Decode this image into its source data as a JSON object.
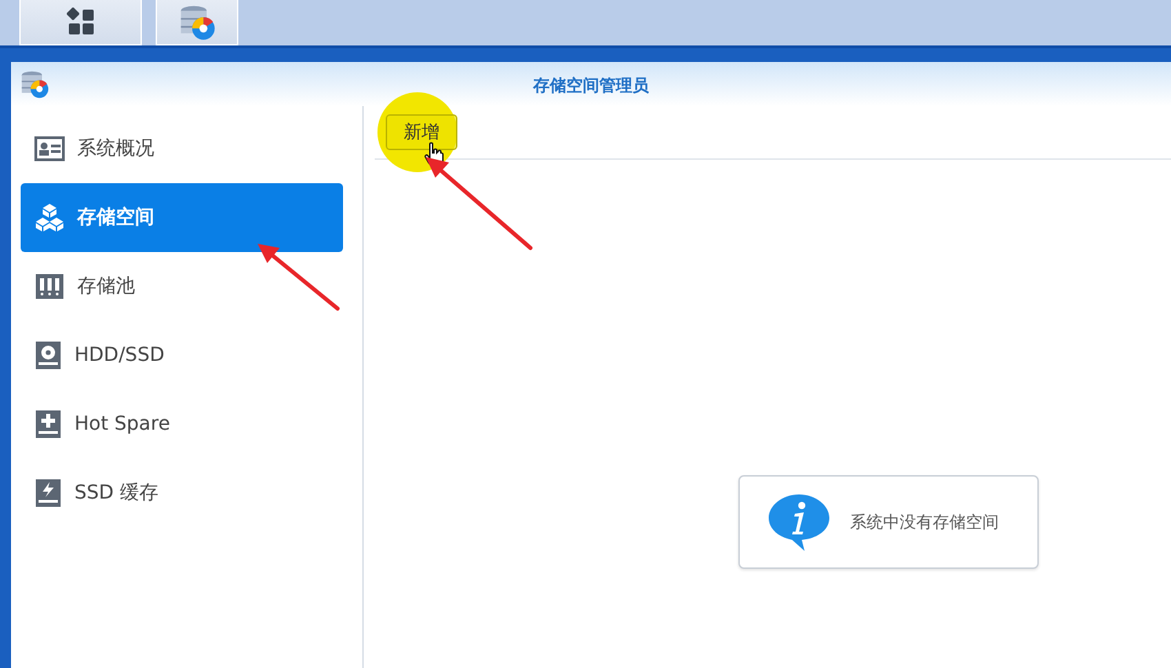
{
  "window": {
    "title": "存储空间管理员"
  },
  "sidebar": {
    "items": [
      {
        "kind": "overview",
        "label": "系统概况",
        "selected": false
      },
      {
        "kind": "volume",
        "label": "存储空间",
        "selected": true
      },
      {
        "kind": "pool",
        "label": "存储池",
        "selected": false
      },
      {
        "kind": "disk",
        "label": "HDD/SSD",
        "selected": false
      },
      {
        "kind": "spare",
        "label": "Hot Spare",
        "selected": false
      },
      {
        "kind": "cache",
        "label": "SSD 缓存",
        "selected": false
      }
    ]
  },
  "toolbar": {
    "buttons": [
      {
        "label": "新增"
      }
    ]
  },
  "message": {
    "text": "系统中没有存储空间"
  }
}
